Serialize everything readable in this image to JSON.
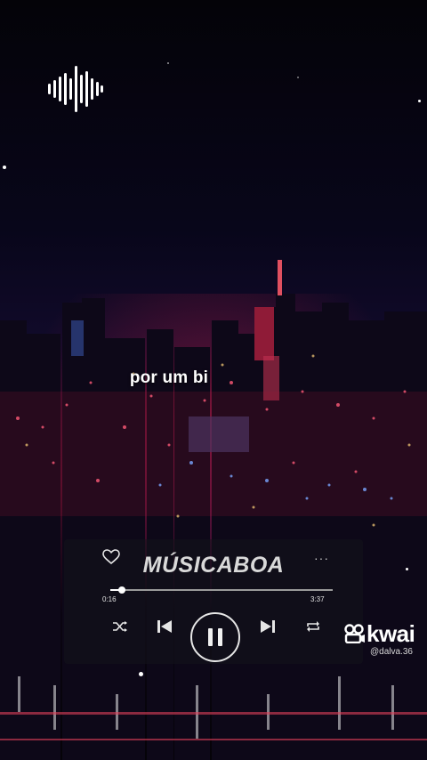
{
  "overlay": {
    "lyric": "por um bi"
  },
  "player": {
    "brand": "MÚSICABOA",
    "more_label": "···",
    "progress": 0.05,
    "time_current": "0:16",
    "time_total": "3:37",
    "controls": [
      "shuffle-icon",
      "previous-icon",
      "pause-icon",
      "next-icon",
      "repeat-icon"
    ]
  },
  "watermark": {
    "brand": "kwai",
    "handle": "@dalva.36"
  },
  "colors": {
    "accent": "#ffffff",
    "glow_red": "#d21e46",
    "glow_blue": "#5028b4"
  }
}
